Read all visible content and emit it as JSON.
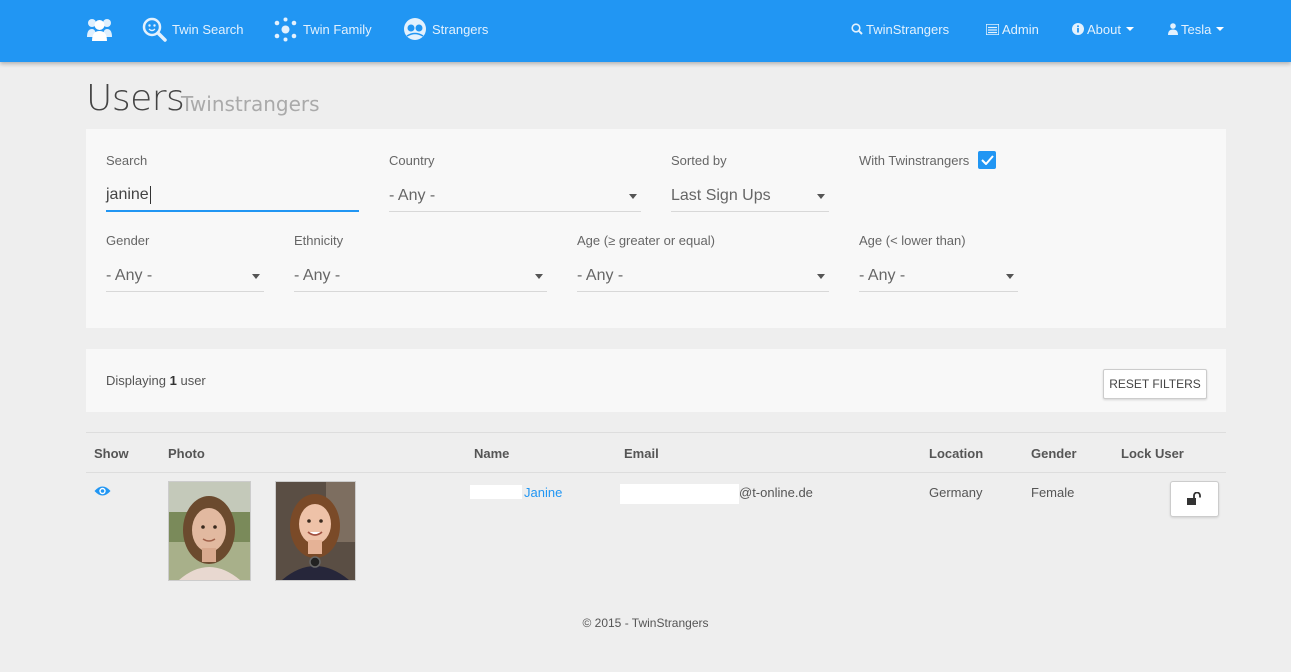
{
  "nav": {
    "twin_search": "Twin Search",
    "twin_family": "Twin Family",
    "strangers": "Strangers",
    "twinstrangers": "TwinStrangers",
    "admin": "Admin",
    "about": "About",
    "user": "Tesla"
  },
  "header": {
    "title": "Users",
    "subtitle": "Twinstrangers"
  },
  "filters": {
    "search": {
      "label": "Search",
      "value": "janine"
    },
    "country": {
      "label": "Country",
      "value": "- Any -"
    },
    "sorted_by": {
      "label": "Sorted by",
      "value": "Last Sign Ups"
    },
    "with_twinstrangers": {
      "label": "With Twinstrangers",
      "checked": true
    },
    "gender": {
      "label": "Gender",
      "value": "- Any -"
    },
    "ethnicity": {
      "label": "Ethnicity",
      "value": "- Any -"
    },
    "age_gte": {
      "label": "Age (≥ greater or equal)",
      "value": "- Any -"
    },
    "age_lt": {
      "label": "Age (< lower than)",
      "value": "- Any -"
    }
  },
  "results": {
    "displaying_prefix": "Displaying",
    "count": "1",
    "displaying_suffix": "user",
    "reset_label": "RESET FILTERS"
  },
  "table": {
    "headers": [
      "Show",
      "Photo",
      "Name",
      "Email",
      "Location",
      "Gender",
      "Lock User"
    ],
    "rows": [
      {
        "name": "Janine",
        "email_domain": "@t-online.de",
        "location": "Germany",
        "gender": "Female"
      }
    ]
  },
  "footer": "© 2015 - TwinStrangers",
  "colors": {
    "brand": "#2196f3",
    "background": "#eeeeee"
  }
}
